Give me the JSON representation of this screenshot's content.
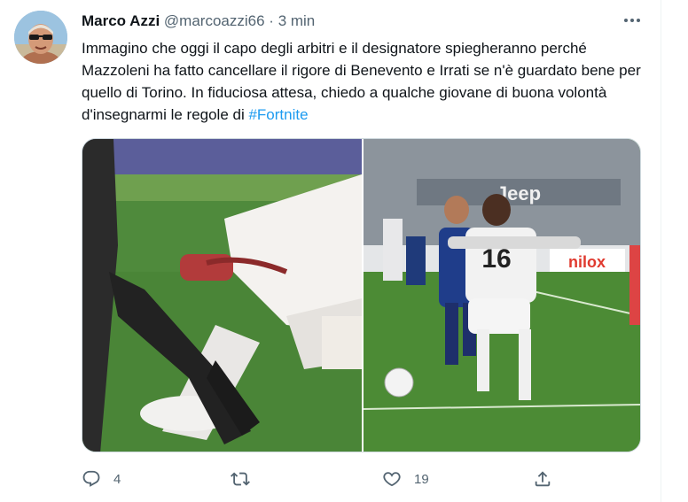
{
  "tweet": {
    "author_name": "Marco Azzi",
    "handle": "@marcoazzi66",
    "separator": "·",
    "time": "3 min",
    "text_main": "Immagino che oggi il capo degli arbitri e il designatore spiegheranno perché Mazzoleni ha fatto cancellare il rigore di Benevento e Irrati se n'è guardato bene per quello di Torino. In fiduciosa attesa, chiedo a qualche giovane di buona volontà d'insegnarmi le regole di ",
    "hashtag": "#Fortnite",
    "media": {
      "right_banner_text": "Jeep",
      "right_board_text": "nilox",
      "player_number": "16"
    },
    "actions": {
      "replies": "4",
      "retweets": "",
      "likes": "19"
    }
  },
  "colors": {
    "accent": "#1d9bf0",
    "secondary_text": "#536471",
    "primary_text": "#0f1419",
    "divider": "#eff3f4"
  },
  "icons": [
    "more-icon",
    "reply-icon",
    "retweet-icon",
    "like-icon",
    "share-icon"
  ]
}
